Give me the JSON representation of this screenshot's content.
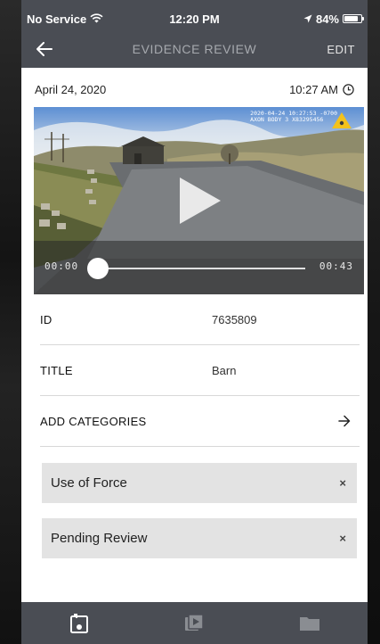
{
  "status_bar": {
    "carrier": "No Service",
    "time": "12:20 PM",
    "battery": "84%",
    "battery_level": 0.84
  },
  "nav": {
    "title": "EVIDENCE REVIEW",
    "edit_label": "EDIT",
    "back_icon": "arrow-left-icon"
  },
  "meta": {
    "date": "April 24, 2020",
    "time": "10:27 AM",
    "time_icon": "clock-icon"
  },
  "video": {
    "stamp_line1": "2020-04-24 10:27:53 -0700",
    "stamp_line2": "AXON BODY 3 X83295456",
    "current_time": "00:00",
    "duration": "00:43",
    "progress": 0,
    "play_icon": "play-icon",
    "colors": {
      "accent_triangle": "#f3c21b"
    }
  },
  "details": {
    "id_label": "ID",
    "id_value": "7635809",
    "title_label": "TITLE",
    "title_value": "Barn",
    "add_categories_label": "ADD CATEGORIES"
  },
  "categories": [
    {
      "label": "Use of Force",
      "remove": "×"
    },
    {
      "label": "Pending Review",
      "remove": "×"
    }
  ],
  "tabbar": {
    "tabs": [
      "camera-capture-icon",
      "video-library-icon",
      "folder-icon"
    ],
    "active_index": 0
  },
  "colors": {
    "header_bg": "#4a4d54",
    "chip_bg": "#e3e3e3",
    "tab_active": "#ffffff",
    "tab_inactive": "#8a8d92"
  }
}
